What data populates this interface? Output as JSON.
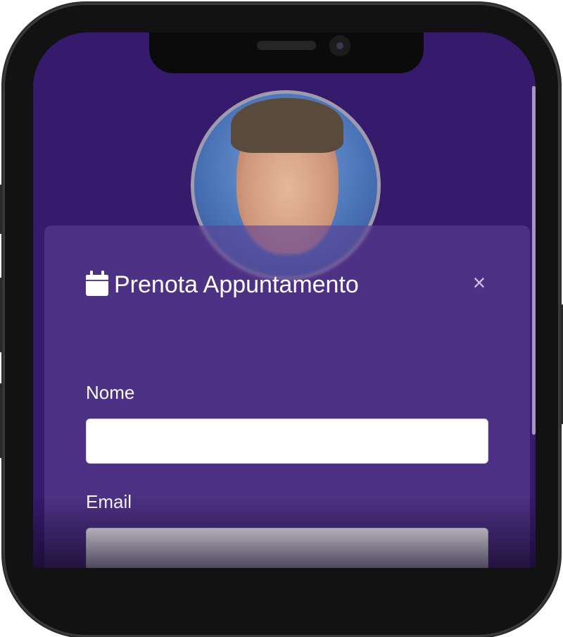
{
  "modal": {
    "title": "Prenota Appuntamento",
    "close_label": "×",
    "fields": {
      "name_label": "Nome",
      "name_value": "",
      "email_label": "Email",
      "email_value": ""
    }
  },
  "icons": {
    "title_icon": "calendar-icon",
    "close_icon": "close-icon"
  },
  "colors": {
    "background": "#361a6b",
    "modal_overlay": "#5c4094"
  }
}
